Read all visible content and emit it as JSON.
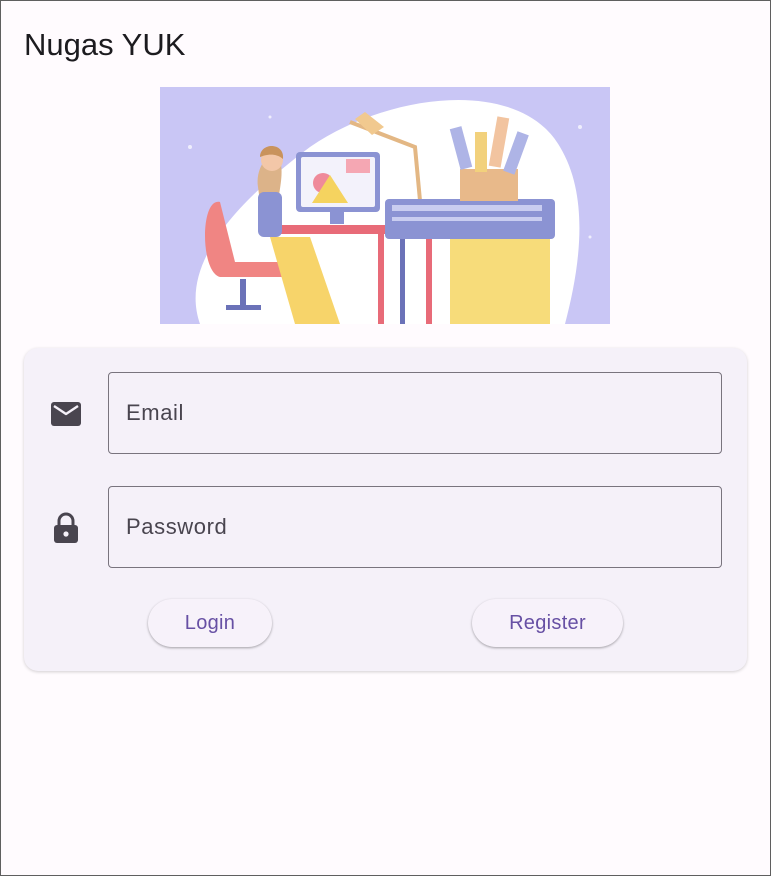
{
  "app": {
    "title": "Nugas YUK"
  },
  "login_form": {
    "email": {
      "icon": "mail-icon",
      "placeholder": "Email",
      "value": ""
    },
    "password": {
      "icon": "lock-icon",
      "placeholder": "Password",
      "value": ""
    },
    "login_label": "Login",
    "register_label": "Register"
  },
  "colors": {
    "background": "#fffbfe",
    "card": "#f5f1f9",
    "accent": "#6750a4",
    "outline": "#79747e",
    "icon": "#49454f",
    "illustration_bg": "#c9c6f5"
  }
}
